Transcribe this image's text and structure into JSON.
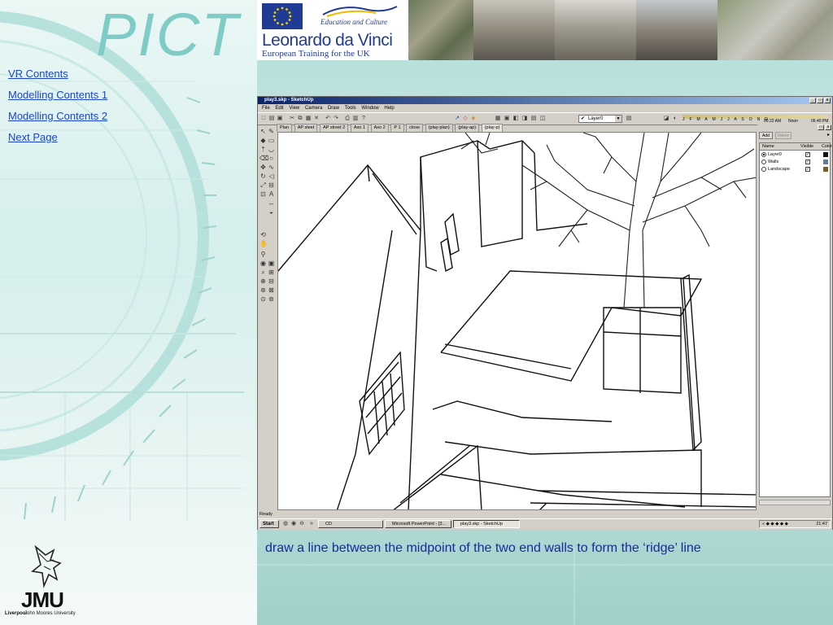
{
  "slide": {
    "logo_text": "PICT",
    "nav": [
      {
        "label": "VR Contents"
      },
      {
        "label": "Modelling Contents 1"
      },
      {
        "label": "Modelling Contents 2"
      },
      {
        "label": "Next Page"
      }
    ],
    "caption": "draw a line between the midpoint of the two end walls to form the ‘ridge’ line",
    "banner": {
      "edu_culture": "Education and Culture",
      "program_title": "Leonardo da Vinci",
      "program_subtitle": "European Training for the UK"
    },
    "jmu": {
      "letters": "JMU",
      "sub_bold": "Liverpool",
      "sub": "John Moores University"
    }
  },
  "app": {
    "title": "play3.skp - SketchUp",
    "window_buttons": [
      "_",
      "□",
      "x"
    ],
    "menus": [
      "File",
      "Edit",
      "View",
      "Camera",
      "Draw",
      "Tools",
      "Window",
      "Help"
    ],
    "layer_select": {
      "value": "Layer0"
    },
    "shadow_months": "J F M A M J J A S O N D",
    "shadow_times": {
      "am": "05:22 AM",
      "noon": "Noon",
      "pm": "06:40 PM"
    },
    "scene_tabs": [
      "Plan",
      "AP steet",
      "AP street 2",
      "Axo 1",
      "Axo 2",
      "P 1",
      "close",
      "(play-plan)",
      "(play-ap)",
      "(play-p)"
    ],
    "active_scene": "(play-p)",
    "layers_panel": {
      "add_label": "Add",
      "delete_label": "Delete",
      "columns": [
        "Name",
        "Visible",
        "Color"
      ],
      "rows": [
        {
          "name": "Layer0",
          "visible": true,
          "color": "#111111",
          "active": true
        },
        {
          "name": "Walls",
          "visible": true,
          "color": "#6a7a9a",
          "active": false
        },
        {
          "name": "Landscape",
          "visible": true,
          "color": "#7a5a2a",
          "active": false
        }
      ]
    },
    "status": "Ready",
    "taskbar": {
      "start": "Start",
      "tasks": [
        {
          "label": "CD"
        },
        {
          "label": "Microsoft PowerPoint - [3..."
        },
        {
          "label": "play3.skp - SketchUp"
        }
      ],
      "clock": "21:47"
    }
  }
}
